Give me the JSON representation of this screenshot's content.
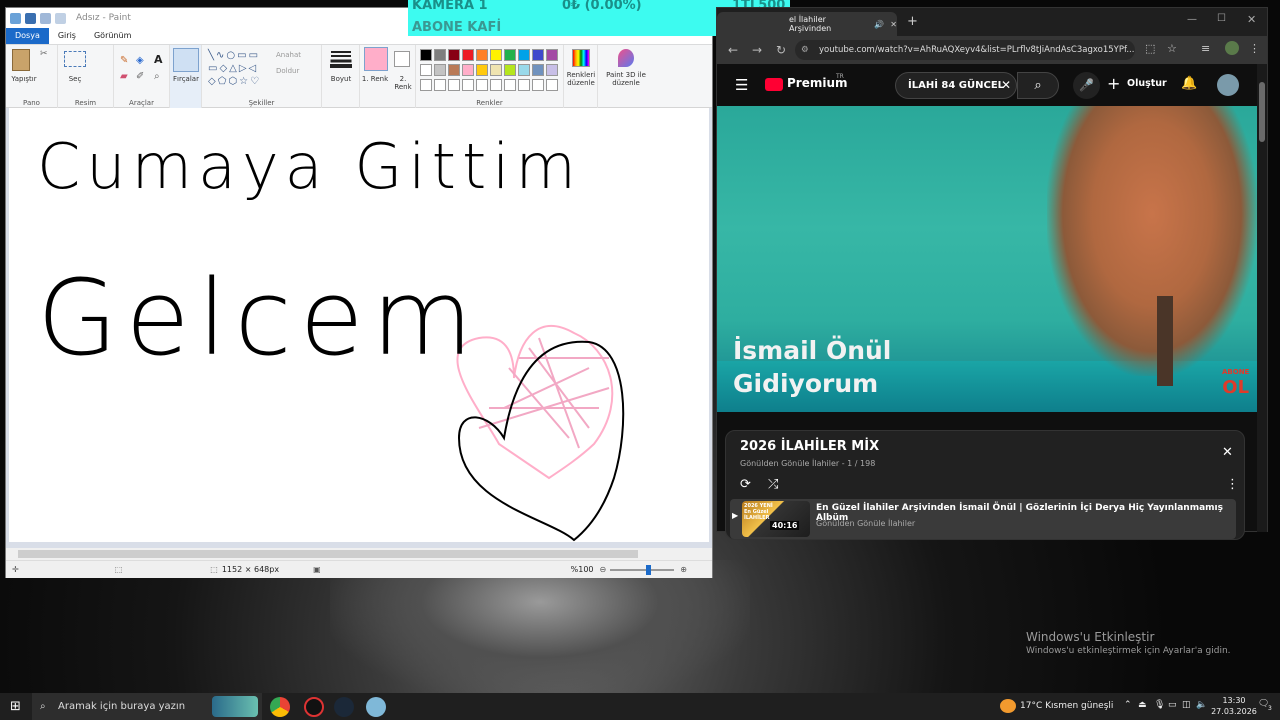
{
  "paint": {
    "window_title": "Adsız - Paint",
    "tabs": [
      "Dosya",
      "Giriş",
      "Görünüm"
    ],
    "ribbon": {
      "paste": "Yapıştır",
      "select": "Seç",
      "brushes": "Fırçalar",
      "outline": "Anahat",
      "fill": "Doldur",
      "size": "Boyut",
      "color1": "1. Renk",
      "color2": "2. Renk",
      "edit_colors": "Renkleri düzenle",
      "paint3d": "Paint 3D ile düzenle",
      "groups": [
        "Pano",
        "Resim",
        "Araçlar",
        "Şekiller",
        "Renkler"
      ]
    },
    "palette_row1": [
      "#000000",
      "#7f7f7f",
      "#880015",
      "#ed1c24",
      "#ff7f27",
      "#fff200",
      "#22b14c",
      "#00a2e8",
      "#3f48cc",
      "#a349a4"
    ],
    "palette_row2": [
      "#ffffff",
      "#c3c3c3",
      "#b97a57",
      "#ffaec9",
      "#ffc90e",
      "#efe4b0",
      "#b5e61d",
      "#99d9ea",
      "#7092be",
      "#c8bfe7"
    ],
    "canvas_text": {
      "line1": "Cumaya Gittim",
      "line2": "Gelcem"
    },
    "status": {
      "dimensions": "1152 × 648px",
      "zoom": "%100"
    }
  },
  "overlay_banner": {
    "camera": "KAMERA 1",
    "amount": "0₺ (0.00%)",
    "goal": "1TL500",
    "subtitle": "ABONE KAFİ"
  },
  "browser": {
    "tab_title": "el İlahiler Arşivinden",
    "url": "youtube.com/watch?v=AhRuAQXeyv4&list=PLrflv8tJiAndAsC3agxo15YPf...",
    "youtube": {
      "logo": "Premium",
      "logo_sup": "TR",
      "search_value": "İLAHİ 84 GÜNCEL",
      "create_label": "Oluştur"
    },
    "video": {
      "title_line1": "İsmail Önül",
      "title_line2": "Gidiyorum",
      "badge_line1": "ABONE",
      "badge_line2": "OL"
    },
    "playlist": {
      "title": "2026 İLAHİLER MİX",
      "subtitle": "Gönülden Gönüle İlahiler - 1 / 198",
      "item_title": "En Güzel İlahiler Arşivinden İsmail Önül | Gözlerinin İçi Derya Hiç Yayınlanmamış Albüm",
      "item_channel": "Gönülden Gönüle İlahiler",
      "item_duration": "40:16",
      "thumb_text": "2026 YENİ En Güzel İLAHİLER"
    }
  },
  "watermark": {
    "title": "Windows'u Etkinleştir",
    "subtitle": "Windows'u etkinleştirmek için Ayarlar'a gidin."
  },
  "taskbar": {
    "search_placeholder": "Aramak için buraya yazın",
    "weather": "17°C  Kısmen güneşli",
    "time": "13:30",
    "date": "27.03.2026",
    "notification_count": "3"
  }
}
